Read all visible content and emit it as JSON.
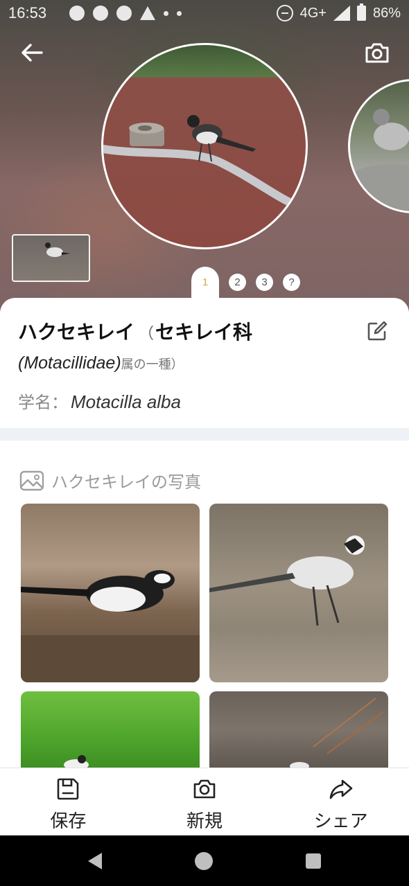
{
  "status_bar": {
    "time": "16:53",
    "network": "4G+",
    "battery": "86%"
  },
  "header": {
    "back_icon": "arrow-left-icon",
    "camera_icon": "camera-icon"
  },
  "gallery": {
    "pages": [
      "1",
      "2",
      "3",
      "?"
    ],
    "active_page": "1"
  },
  "species": {
    "name": "ハクセキレイ",
    "paren_open": "（",
    "family_ja": "セキレイ科",
    "family_latin": "(Motacillidae)",
    "family_suffix": "属の一種）",
    "sci_label": "学名：",
    "sci_name": "Motacilla alba"
  },
  "photos": {
    "title": "ハクセキレイの写真",
    "icon": "image-icon"
  },
  "bottom_nav": {
    "items": [
      {
        "label": "保存",
        "icon": "save-icon"
      },
      {
        "label": "新規",
        "icon": "camera-icon"
      },
      {
        "label": "シェア",
        "icon": "share-icon"
      }
    ]
  },
  "colors": {
    "accent": "#d7a642",
    "band": "#eef1f5"
  }
}
